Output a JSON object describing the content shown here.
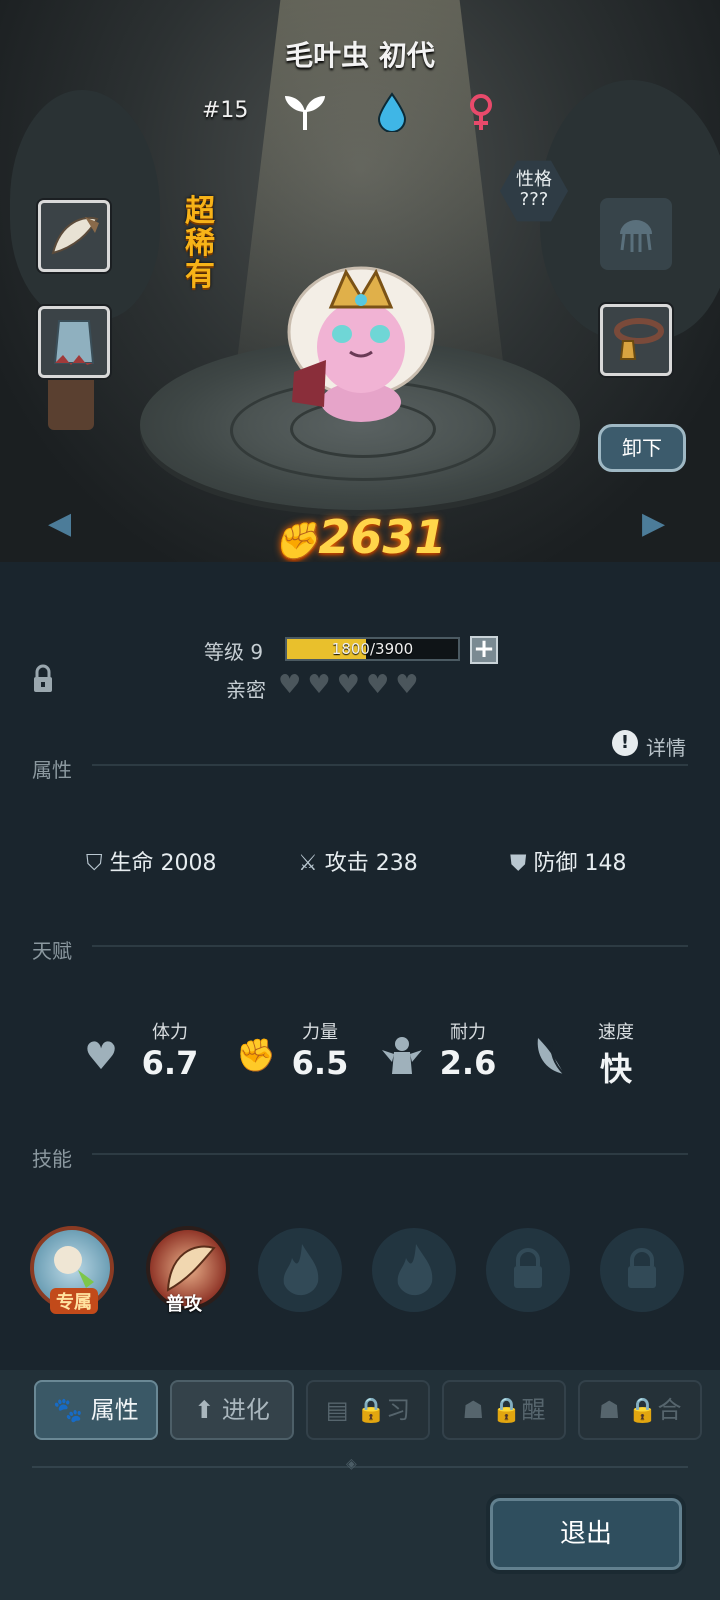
{
  "pet": {
    "name": "毛叶虫 初代",
    "number": "#15",
    "rarity": "超稀有",
    "personality_label": "性格",
    "personality_value": "???",
    "power": "2631",
    "unequip_label": "卸下",
    "icons": [
      "leaf-icon",
      "water-drop-icon",
      "female-icon"
    ]
  },
  "level": {
    "label": "等级 9",
    "xp_text": "1800/3900",
    "xp_fraction": 0.46,
    "intimacy_label": "亲密",
    "hearts": 5
  },
  "sections": {
    "attributes": "属性",
    "details": "详情",
    "talent": "天赋",
    "skills": "技能"
  },
  "attributes": [
    {
      "label": "生命",
      "value": "2008",
      "icon": "shield-heart-icon"
    },
    {
      "label": "攻击",
      "value": "238",
      "icon": "sword-icon"
    },
    {
      "label": "防御",
      "value": "148",
      "icon": "defense-shield-icon"
    }
  ],
  "talents": [
    {
      "label": "体力",
      "value": "6.7",
      "icon": "heart-icon"
    },
    {
      "label": "力量",
      "value": "6.5",
      "icon": "fist-icon"
    },
    {
      "label": "耐力",
      "value": "2.6",
      "icon": "muscle-icon"
    },
    {
      "label": "速度",
      "value": "快",
      "icon": "wing-icon"
    }
  ],
  "skills": [
    {
      "tag": "专属",
      "state": "exclusive"
    },
    {
      "tag": "普攻",
      "state": "normal"
    },
    {
      "tag": "",
      "state": "empty"
    },
    {
      "tag": "",
      "state": "empty"
    },
    {
      "tag": "",
      "state": "locked"
    },
    {
      "tag": "",
      "state": "locked"
    }
  ],
  "tabs": [
    {
      "label": "属性",
      "active": true
    },
    {
      "label": "进化",
      "active": false
    },
    {
      "label": "习",
      "active": false,
      "locked": true
    },
    {
      "label": "醒",
      "active": false,
      "locked": true
    },
    {
      "label": "合",
      "active": false,
      "locked": true
    }
  ],
  "exit_label": "退出",
  "colors": {
    "background": "#1a252d",
    "rarity": "#f7b318",
    "power": "#ffd54a",
    "xp_fill": "#e9c02c",
    "female": "#e84a6b",
    "water": "#3fb6e6"
  }
}
